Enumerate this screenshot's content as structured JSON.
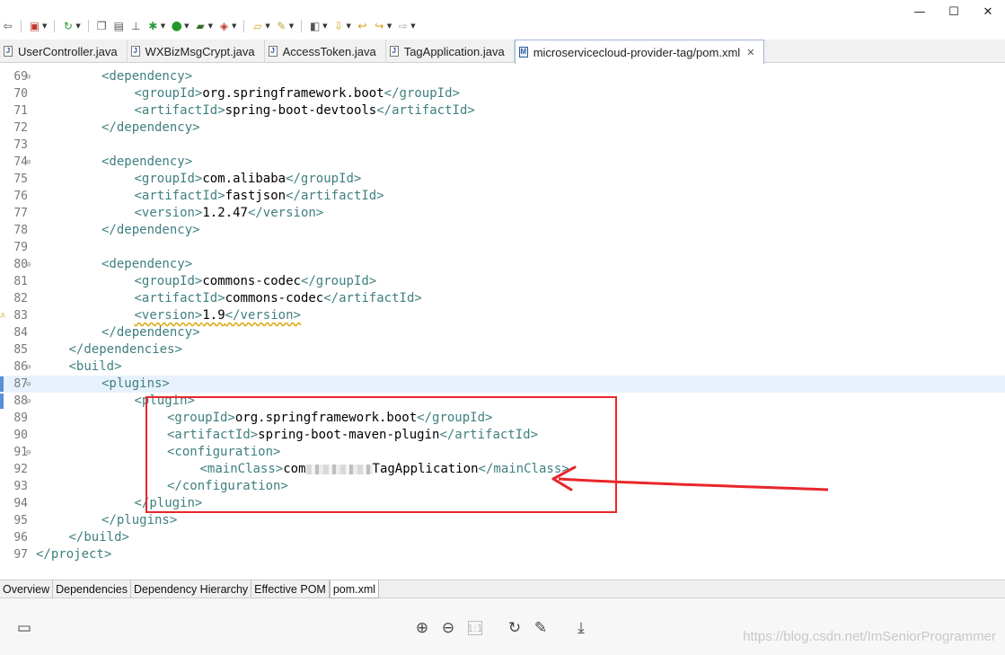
{
  "window": {
    "controls": [
      {
        "name": "minimize-button",
        "glyph": "—"
      },
      {
        "name": "maximize-button",
        "glyph": "☐"
      },
      {
        "name": "close-button",
        "glyph": "✕"
      }
    ]
  },
  "editor_tabs": [
    {
      "label": "UserController.java",
      "icon": "java-file-icon",
      "active": false
    },
    {
      "label": "WXBizMsgCrypt.java",
      "icon": "java-file-icon",
      "active": false
    },
    {
      "label": "AccessToken.java",
      "icon": "java-file-icon",
      "active": false
    },
    {
      "label": "TagApplication.java",
      "icon": "java-file-icon",
      "active": false
    },
    {
      "label": "microservicecloud-provider-tag/pom.xml",
      "icon": "xml-file-icon",
      "active": true,
      "close": "✕"
    }
  ],
  "code_lines": [
    {
      "n": "69",
      "fold": true,
      "indent": 2,
      "tokens": [
        {
          "t": "<dependency>",
          "k": "tag"
        }
      ]
    },
    {
      "n": "70",
      "indent": 3,
      "tokens": [
        {
          "t": "<groupId>",
          "k": "tag"
        },
        {
          "t": "org.springframework.boot",
          "k": "txt"
        },
        {
          "t": "</groupId>",
          "k": "tag"
        }
      ]
    },
    {
      "n": "71",
      "indent": 3,
      "tokens": [
        {
          "t": "<artifactId>",
          "k": "tag"
        },
        {
          "t": "spring-boot-devtools",
          "k": "txt"
        },
        {
          "t": "</artifactId>",
          "k": "tag"
        }
      ]
    },
    {
      "n": "72",
      "indent": 2,
      "tokens": [
        {
          "t": "</dependency>",
          "k": "tag"
        }
      ]
    },
    {
      "n": "73",
      "indent": 0,
      "tokens": []
    },
    {
      "n": "74",
      "fold": true,
      "indent": 2,
      "tokens": [
        {
          "t": "<dependency>",
          "k": "tag"
        }
      ]
    },
    {
      "n": "75",
      "indent": 3,
      "tokens": [
        {
          "t": "<groupId>",
          "k": "tag"
        },
        {
          "t": "com.alibaba",
          "k": "txt"
        },
        {
          "t": "</groupId>",
          "k": "tag"
        }
      ]
    },
    {
      "n": "76",
      "indent": 3,
      "tokens": [
        {
          "t": "<artifactId>",
          "k": "tag"
        },
        {
          "t": "fastjson",
          "k": "txt"
        },
        {
          "t": "</artifactId>",
          "k": "tag"
        }
      ]
    },
    {
      "n": "77",
      "indent": 3,
      "tokens": [
        {
          "t": "<version>",
          "k": "tag"
        },
        {
          "t": "1.2.47",
          "k": "txt"
        },
        {
          "t": "</version>",
          "k": "tag"
        }
      ]
    },
    {
      "n": "78",
      "indent": 2,
      "tokens": [
        {
          "t": "</dependency>",
          "k": "tag"
        }
      ]
    },
    {
      "n": "79",
      "indent": 0,
      "tokens": []
    },
    {
      "n": "80",
      "fold": true,
      "indent": 2,
      "tokens": [
        {
          "t": "<dependency>",
          "k": "tag"
        }
      ]
    },
    {
      "n": "81",
      "indent": 3,
      "tokens": [
        {
          "t": "<groupId>",
          "k": "tag"
        },
        {
          "t": "commons-codec",
          "k": "txt"
        },
        {
          "t": "</groupId>",
          "k": "tag"
        }
      ]
    },
    {
      "n": "82",
      "indent": 3,
      "tokens": [
        {
          "t": "<artifactId>",
          "k": "tag"
        },
        {
          "t": "commons-codec",
          "k": "txt"
        },
        {
          "t": "</artifactId>",
          "k": "tag"
        }
      ]
    },
    {
      "n": "83",
      "indent": 3,
      "warning": true,
      "tokens": [
        {
          "t": "<version>",
          "k": "tag",
          "warn": true
        },
        {
          "t": "1.9",
          "k": "txt",
          "warn": true
        },
        {
          "t": "</version>",
          "k": "tag",
          "warn": true
        }
      ]
    },
    {
      "n": "84",
      "indent": 2,
      "tokens": [
        {
          "t": "</dependency>",
          "k": "tag"
        }
      ]
    },
    {
      "n": "85",
      "indent": 1,
      "tokens": [
        {
          "t": "</dependencies>",
          "k": "tag"
        }
      ]
    },
    {
      "n": "86",
      "fold": true,
      "indent": 1,
      "tokens": [
        {
          "t": "<build>",
          "k": "tag"
        }
      ]
    },
    {
      "n": "87",
      "fold": true,
      "indent": 2,
      "current": true,
      "marker": true,
      "tokens": [
        {
          "t": "<plugins>",
          "k": "tag"
        }
      ]
    },
    {
      "n": "88",
      "fold": true,
      "indent": 3,
      "marker": true,
      "tokens": [
        {
          "t": "<plugin>",
          "k": "tag"
        }
      ]
    },
    {
      "n": "89",
      "indent": 4,
      "tokens": [
        {
          "t": "<groupId>",
          "k": "tag"
        },
        {
          "t": "org.springframework.boot",
          "k": "txt"
        },
        {
          "t": "</groupId>",
          "k": "tag"
        }
      ]
    },
    {
      "n": "90",
      "indent": 4,
      "tokens": [
        {
          "t": "<artifactId>",
          "k": "tag"
        },
        {
          "t": "spring-boot-maven-plugin",
          "k": "txt"
        },
        {
          "t": "</artifactId>",
          "k": "tag"
        }
      ]
    },
    {
      "n": "91",
      "fold": true,
      "indent": 4,
      "tokens": [
        {
          "t": "<configuration>",
          "k": "tag"
        }
      ]
    },
    {
      "n": "92",
      "indent": 5,
      "tokens": [
        {
          "t": "<mainClass>",
          "k": "tag"
        },
        {
          "t": "com",
          "k": "txt"
        },
        {
          "t": "",
          "k": "blur"
        },
        {
          "t": "TagApplication",
          "k": "txt"
        },
        {
          "t": "</mainClass>",
          "k": "tag"
        }
      ]
    },
    {
      "n": "93",
      "indent": 4,
      "tokens": [
        {
          "t": "</configuration>",
          "k": "tag"
        }
      ]
    },
    {
      "n": "94",
      "indent": 3,
      "tokens": [
        {
          "t": "</plugin>",
          "k": "tag"
        }
      ]
    },
    {
      "n": "95",
      "indent": 2,
      "tokens": [
        {
          "t": "</plugins>",
          "k": "tag"
        }
      ]
    },
    {
      "n": "96",
      "indent": 1,
      "tokens": [
        {
          "t": "</build>",
          "k": "tag"
        }
      ]
    },
    {
      "n": "97",
      "indent": 0,
      "tokens": [
        {
          "t": "</project>",
          "k": "tag"
        }
      ]
    }
  ],
  "pom_tabs": [
    {
      "label": "Overview",
      "active": false
    },
    {
      "label": "Dependencies",
      "active": false
    },
    {
      "label": "Dependency Hierarchy",
      "active": false
    },
    {
      "label": "Effective POM",
      "active": false
    },
    {
      "label": "pom.xml",
      "active": true
    }
  ],
  "bottom_toolbar": {
    "icons": [
      "layout-icon",
      "zoom-in-icon",
      "zoom-out-icon",
      "actual-size-icon",
      "rotate-icon",
      "edit-icon",
      "download-icon"
    ]
  },
  "watermark": "https://blog.csdn.net/ImSeniorProgrammer",
  "annotation": {
    "color": "#e8262a"
  }
}
